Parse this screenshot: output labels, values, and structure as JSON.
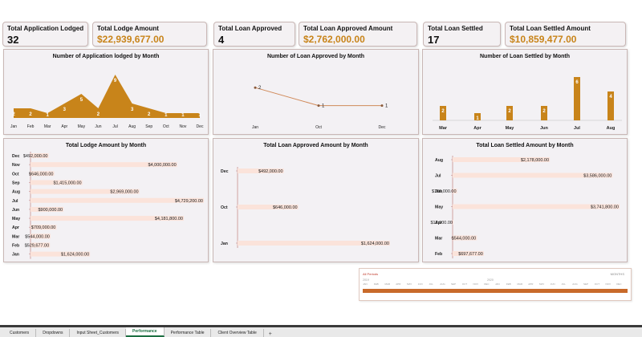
{
  "kpis": {
    "app_lodged": {
      "title": "Total Application Lodged",
      "value": "32"
    },
    "lodge_amount": {
      "title": "Total Lodge Amount",
      "value": "$22,939,677.00"
    },
    "loan_approved": {
      "title": "Total Loan Approved",
      "value": "4"
    },
    "approved_amount": {
      "title": "Total Loan Approved Amount",
      "value": "$2,762,000.00"
    },
    "loan_settled": {
      "title": "Total Loan Settled",
      "value": "17"
    },
    "settled_amount": {
      "title": "Total Loan Settled Amount",
      "value": "$10,859,477.00"
    }
  },
  "colors": {
    "accent": "#c8841a",
    "bar_light": "#fbe3da",
    "axis": "#c98f8c"
  },
  "chart_data": [
    {
      "type": "area",
      "title": "Number of Application lodged by Month",
      "categories": [
        "Jan",
        "Feb",
        "Mar",
        "Apr",
        "May",
        "Jun",
        "Jul",
        "Aug",
        "Sep",
        "Oct",
        "Nov",
        "Dec"
      ],
      "values": [
        2,
        2,
        1,
        3,
        5,
        2,
        9,
        3,
        2,
        1,
        1,
        1
      ],
      "labels": [
        "2",
        "2",
        "1",
        "3",
        "5",
        "2",
        "9",
        "3",
        "2",
        "1",
        "1",
        "1"
      ]
    },
    {
      "type": "line",
      "title": "Number of Loan Approved by Month",
      "categories": [
        "Jan",
        "Oct",
        "Dec"
      ],
      "values": [
        2,
        1,
        1
      ],
      "labels": [
        "2",
        "1",
        "1"
      ]
    },
    {
      "type": "bar",
      "title": "Number of Loan Settled by Month",
      "categories": [
        "Mar",
        "Apr",
        "May",
        "Jun",
        "Jul",
        "Aug"
      ],
      "values": [
        2,
        1,
        2,
        2,
        6,
        4
      ],
      "labels": [
        "2",
        "1",
        "2",
        "2",
        "6",
        "4"
      ]
    },
    {
      "type": "bar",
      "orientation": "horizontal",
      "title": "Total Lodge Amount by Month",
      "categories": [
        "Dec",
        "Nov",
        "Oct",
        "Sep",
        "Aug",
        "Jul",
        "Jun",
        "May",
        "Apr",
        "Mar",
        "Feb",
        "Jan"
      ],
      "values": [
        492000,
        4000000,
        646000,
        1415000,
        2969000,
        4729200,
        900000,
        4181800,
        709000,
        544000,
        529677,
        1624000
      ],
      "labels": [
        "$492,000.00",
        "$4,000,000.00",
        "$646,000.00",
        "$1,415,000.00",
        "$2,969,000.00",
        "$4,729,200.00",
        "$900,000.00",
        "$4,181,800.00",
        "$709,000.00",
        "$544,000.00",
        "$529,677.00",
        "$1,624,000.00"
      ]
    },
    {
      "type": "bar",
      "orientation": "horizontal",
      "title": "Total Loan Approved Amount by Month",
      "categories": [
        "Dec",
        "Oct",
        "Jan"
      ],
      "values": [
        492000,
        646000,
        1624000
      ],
      "labels": [
        "$492,000.00",
        "$646,000.00",
        "$1,624,000.00"
      ]
    },
    {
      "type": "bar",
      "orientation": "horizontal",
      "title": "Total Loan Settled Amount by Month",
      "categories": [
        "Aug",
        "Jul",
        "Jun",
        "May",
        "Apr",
        "Mar",
        "Feb"
      ],
      "values": [
        2178000,
        3586000,
        100000,
        3741800,
        12000,
        544000,
        697677
      ],
      "labels": [
        "$2,178,000.00",
        "$3,586,000.00",
        "$100,000.00",
        "$3,741,800.00",
        "$12,000.00",
        "$544,000.00",
        "$697,677.00"
      ]
    }
  ],
  "slicer": {
    "title": "All Periods",
    "selector": "MONTHS",
    "year1": "2019",
    "year2": "2020",
    "months": [
      "JAN",
      "FEB",
      "MAR",
      "APR",
      "MAY",
      "JUN",
      "JUL",
      "AUG",
      "SEP",
      "OCT",
      "NOV",
      "DEC",
      "JAN",
      "FEB",
      "MAR",
      "APR",
      "MAY",
      "JUN",
      "JUL",
      "AUG",
      "SEP",
      "OCT",
      "NOV",
      "DEC"
    ]
  },
  "tabs": [
    "Customers",
    "Dropdowns",
    "Input Sheet_Customers",
    "Performance",
    "Performance Table",
    "Client Overview Table"
  ],
  "active_tab": "Performance",
  "add_tab": "+"
}
